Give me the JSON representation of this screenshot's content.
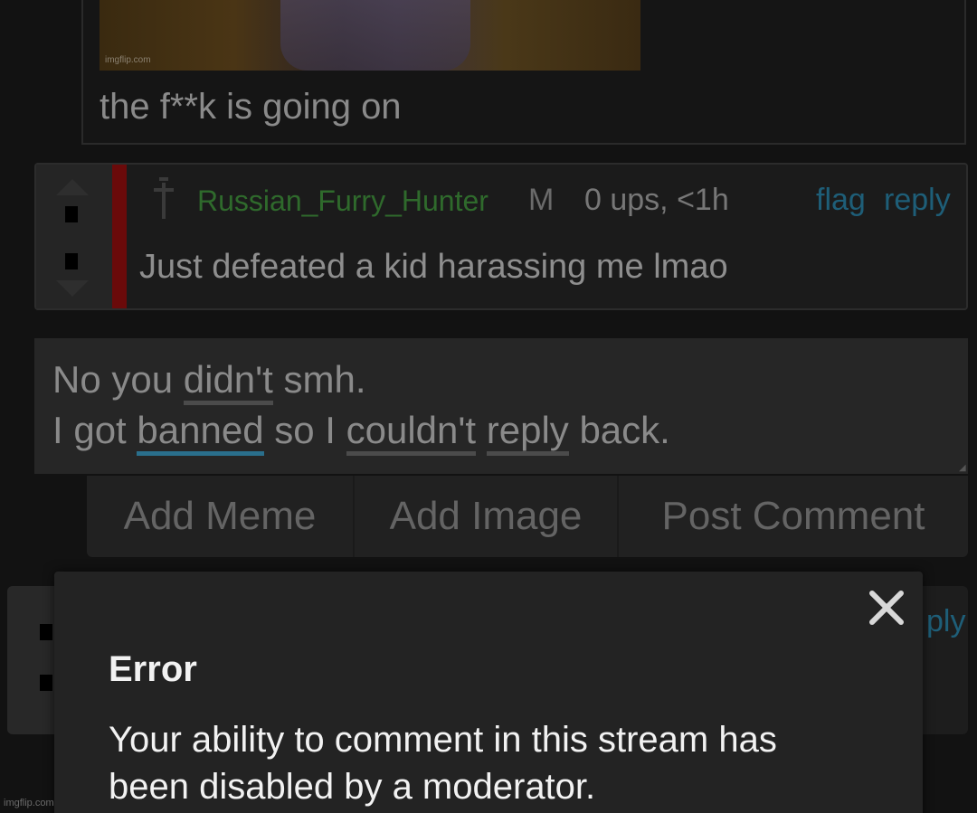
{
  "parent": {
    "image_watermark": "imgflip.com",
    "text": "the f**k is going on"
  },
  "comment": {
    "username": "Russian_Furry_Hunter",
    "gender": "M",
    "meta": "0 ups, <1h",
    "flag_label": "flag",
    "reply_label": "reply",
    "body": "Just defeated a kid harassing me lmao",
    "username_color": "#2f6a2c",
    "rank_bar_color": "#6a0a0a",
    "link_color": "#1e5e78"
  },
  "reply_input": {
    "line1_pre": "No you ",
    "line1_word": "didn't",
    "line1_post": " smh.",
    "line2_a": "I got ",
    "line2_word1": "banned",
    "line2_b": " so I ",
    "line2_word2": "couldn't",
    "line2_c": " ",
    "line2_word3": "reply",
    "line2_d": " back."
  },
  "actions": {
    "add_meme": "Add Meme",
    "add_image": "Add Image",
    "post_comment": "Post Comment"
  },
  "background_comment": {
    "reply_fragment": "ply"
  },
  "modal": {
    "title": "Error",
    "message": "Your ability to comment in this stream has been disabled by a moderator.",
    "close_icon": "close-icon"
  },
  "footer": {
    "watermark": "imgflip.com"
  }
}
